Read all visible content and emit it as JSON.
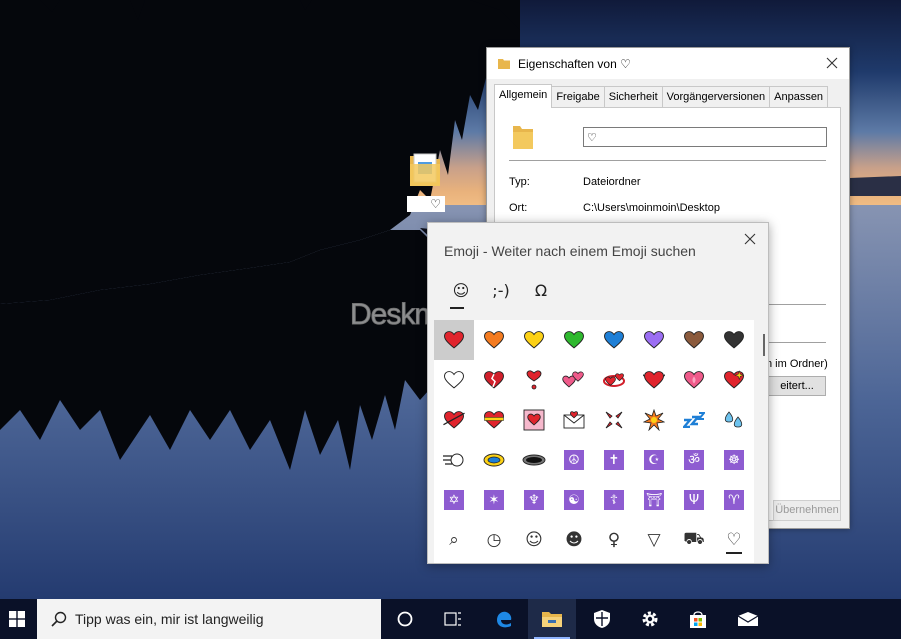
{
  "desktop": {
    "icon_label": "♡",
    "watermark": "Deskmodder.de"
  },
  "properties_dialog": {
    "title": "Eigenschaften von ♡",
    "tabs": [
      "Allgemein",
      "Freigabe",
      "Sicherheit",
      "Vorgängerversionen",
      "Anpassen"
    ],
    "active_tab": "Allgemein",
    "name_value": "♡",
    "type_label": "Typ:",
    "type_value": "Dateiordner",
    "location_label": "Ort:",
    "location_value": "C:\\Users\\moinmoin\\Desktop",
    "partial_text": "n im Ordner)",
    "advanced_button_partial": "eitert...",
    "apply_button": "Übernehmen"
  },
  "emoji_panel": {
    "header": "Emoji - Weiter nach einem Emoji suchen",
    "categories": [
      "☺",
      ";-)",
      "Ω"
    ],
    "active_category": 0,
    "rows": [
      [
        "heart-red",
        "heart-orange",
        "heart-yellow",
        "heart-green",
        "heart-blue",
        "heart-purple",
        "heart-brown",
        "heart-black"
      ],
      [
        "heart-white",
        "broken-heart",
        "heart-exclamation",
        "two-hearts",
        "revolving-hearts",
        "beating-heart",
        "growing-heart",
        "sparkling-heart"
      ],
      [
        "heart-with-arrow",
        "heart-with-ribbon",
        "heart-decoration",
        "love-letter",
        "anger-symbol",
        "collision",
        "zzz",
        "sweat-droplets"
      ],
      [
        "dash",
        "dizzy",
        "hole",
        "peace-symbol",
        "latin-cross",
        "star-and-crescent",
        "om",
        "wheel-of-dharma"
      ],
      [
        "star-of-david",
        "six-pointed-star",
        "menorah",
        "yin-yang",
        "orthodox-cross",
        "place-of-worship",
        "trident",
        "aries"
      ],
      [
        "magnifier-tab-icon",
        "clock-tab-icon",
        "smiley-tab-icon",
        "people-tab-icon",
        "balloon-tab-icon",
        "pizza-tab-icon",
        "car-tab-icon",
        "heart-tab-icon"
      ]
    ],
    "symbol_glyphs": {
      "peace-symbol": "☮",
      "latin-cross": "✝",
      "star-and-crescent": "☪",
      "om": "ॐ",
      "wheel-of-dharma": "☸",
      "star-of-david": "✡",
      "six-pointed-star": "✶",
      "menorah": "♆",
      "yin-yang": "☯",
      "orthodox-cross": "☦",
      "place-of-worship": "⛩",
      "trident": "Ψ",
      "aries": "♈"
    },
    "tab_glyphs": {
      "magnifier-tab-icon": "⌕",
      "clock-tab-icon": "◷",
      "smiley-tab-icon": "☺",
      "people-tab-icon": "☻",
      "balloon-tab-icon": "♀",
      "pizza-tab-icon": "▽",
      "car-tab-icon": "⛟",
      "heart-tab-icon": "♡"
    },
    "colors": {
      "heart-red": "#e0242d",
      "heart-orange": "#f47b20",
      "heart-yellow": "#fcd116",
      "heart-green": "#2eb82e",
      "heart-blue": "#1e7fd6",
      "heart-purple": "#9b6ef3",
      "heart-brown": "#8b5a3c",
      "heart-black": "#333333",
      "symbol-tile": "#8e5cd1"
    }
  },
  "taskbar": {
    "search_text": "Tipp was ein, mir ist langweilig",
    "items": [
      "cortana-icon",
      "task-view-icon",
      "edge-icon",
      "file-explorer-icon",
      "security-icon",
      "settings-icon",
      "store-icon",
      "mail-icon"
    ],
    "active_item": "file-explorer-icon"
  }
}
